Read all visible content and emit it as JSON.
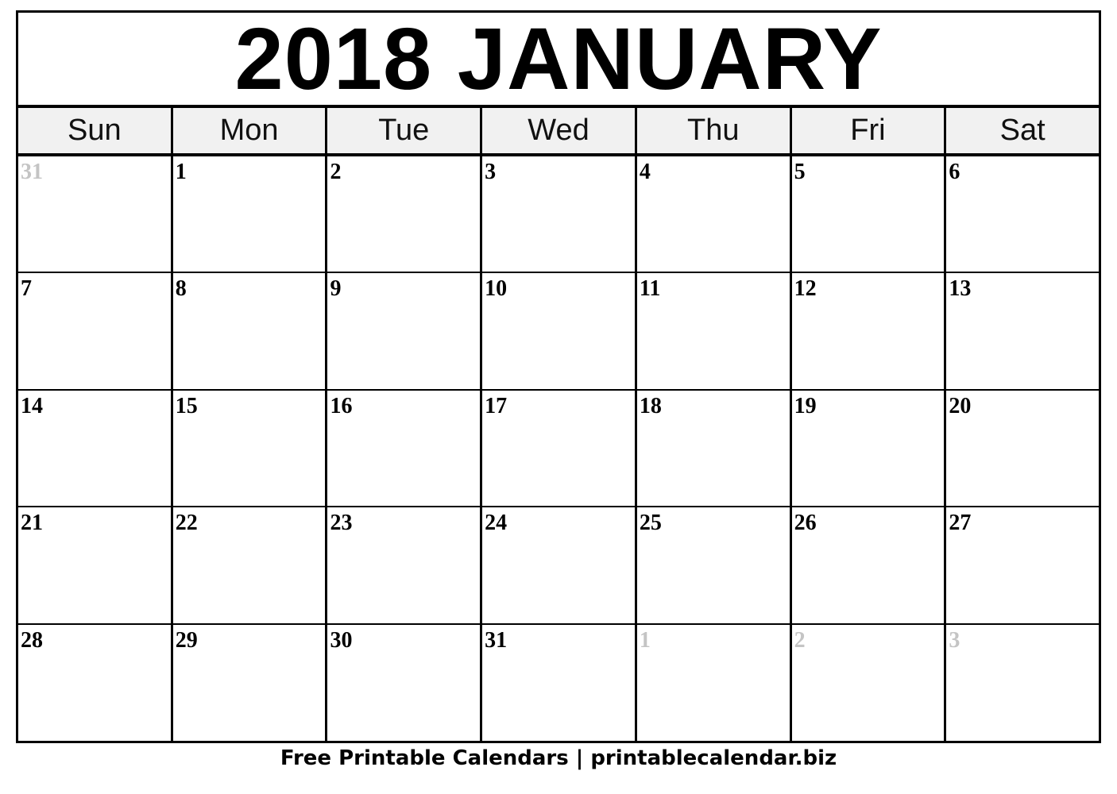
{
  "title": "2018 JANUARY",
  "weekdays": [
    "Sun",
    "Mon",
    "Tue",
    "Wed",
    "Thu",
    "Fri",
    "Sat"
  ],
  "weeks": [
    [
      {
        "d": "31",
        "other": true
      },
      {
        "d": "1"
      },
      {
        "d": "2"
      },
      {
        "d": "3"
      },
      {
        "d": "4"
      },
      {
        "d": "5"
      },
      {
        "d": "6"
      }
    ],
    [
      {
        "d": "7"
      },
      {
        "d": "8"
      },
      {
        "d": "9"
      },
      {
        "d": "10"
      },
      {
        "d": "11"
      },
      {
        "d": "12"
      },
      {
        "d": "13"
      }
    ],
    [
      {
        "d": "14"
      },
      {
        "d": "15"
      },
      {
        "d": "16"
      },
      {
        "d": "17"
      },
      {
        "d": "18"
      },
      {
        "d": "19"
      },
      {
        "d": "20"
      }
    ],
    [
      {
        "d": "21"
      },
      {
        "d": "22"
      },
      {
        "d": "23"
      },
      {
        "d": "24"
      },
      {
        "d": "25"
      },
      {
        "d": "26"
      },
      {
        "d": "27"
      }
    ],
    [
      {
        "d": "28"
      },
      {
        "d": "29"
      },
      {
        "d": "30"
      },
      {
        "d": "31"
      },
      {
        "d": "1",
        "other": true
      },
      {
        "d": "2",
        "other": true
      },
      {
        "d": "3",
        "other": true
      }
    ]
  ],
  "footer": "Free Printable Calendars | printablecalendar.biz"
}
